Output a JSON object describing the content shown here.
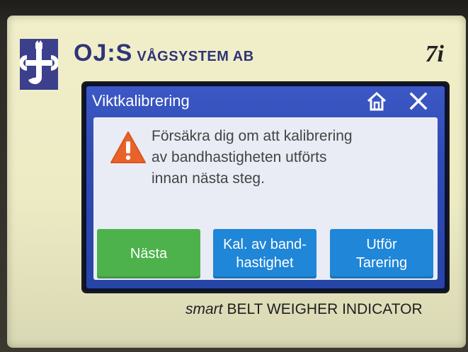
{
  "brand": {
    "name_big": "OJ:S",
    "name_small": "VÅGSYSTEM AB",
    "model": "7i",
    "logo_icon": "oj-logo-icon",
    "brand_color": "#2f3478"
  },
  "screen": {
    "title": "Viktkalibrering",
    "home_icon": "home-icon",
    "close_icon": "close-icon",
    "accent": "#3c58c4"
  },
  "dialog": {
    "icon": "warning-triangle-icon",
    "message_lines": [
      "Försäkra dig om att kalibrering",
      "av bandhastigheten utförts",
      "innan nästa steg."
    ],
    "buttons": {
      "next": "Nästa",
      "belt_line1": "Kal. av band-",
      "belt_line2": "hastighet",
      "tare_line1": "Utför",
      "tare_line2": "Tarering"
    },
    "colors": {
      "next": "#4db24b",
      "action": "#1f86d8",
      "warning": "#e8622a"
    }
  },
  "footer": {
    "smart": "smart",
    "rest": "BELT WEIGHER INDICATOR"
  }
}
